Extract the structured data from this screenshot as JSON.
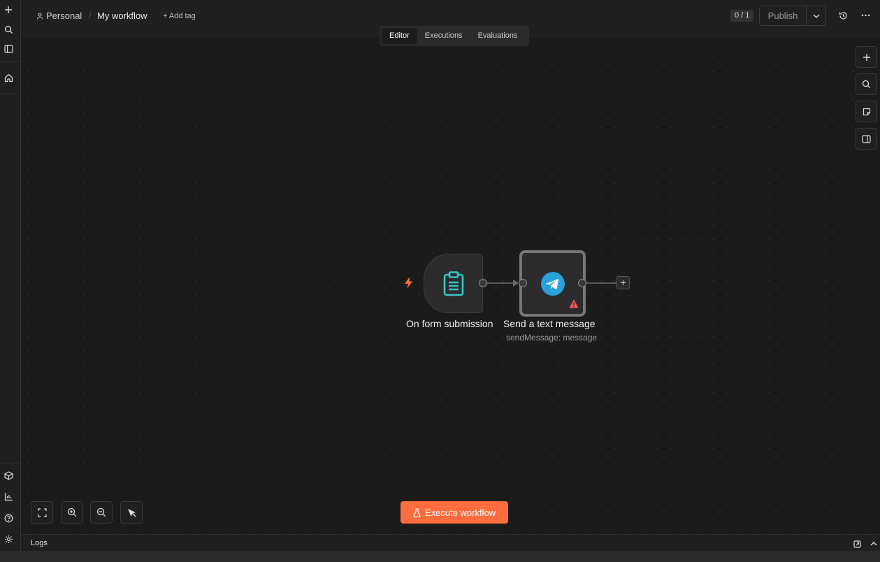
{
  "header": {
    "project": "Personal",
    "separator": "/",
    "workflow_name": "My workflow",
    "add_tag": "+ Add tag",
    "counter": "0 / 1",
    "publish": "Publish"
  },
  "tabs": [
    {
      "label": "Editor",
      "active": true
    },
    {
      "label": "Executions",
      "active": false
    },
    {
      "label": "Evaluations",
      "active": false
    }
  ],
  "nodes": {
    "trigger": {
      "label": "On form submission",
      "icon": "form-clipboard-icon"
    },
    "telegram": {
      "label": "Send a text message",
      "subtitle": "sendMessage: message",
      "icon": "telegram-icon",
      "warning": true
    }
  },
  "execute": {
    "label": "Execute workflow"
  },
  "logs": {
    "label": "Logs"
  },
  "colors": {
    "accent": "#ff6d3f",
    "trigger_bolt": "#ff6d3f",
    "form_icon": "#35c6c6",
    "telegram": "#2aa1da",
    "warning": "#ff5a5a"
  }
}
